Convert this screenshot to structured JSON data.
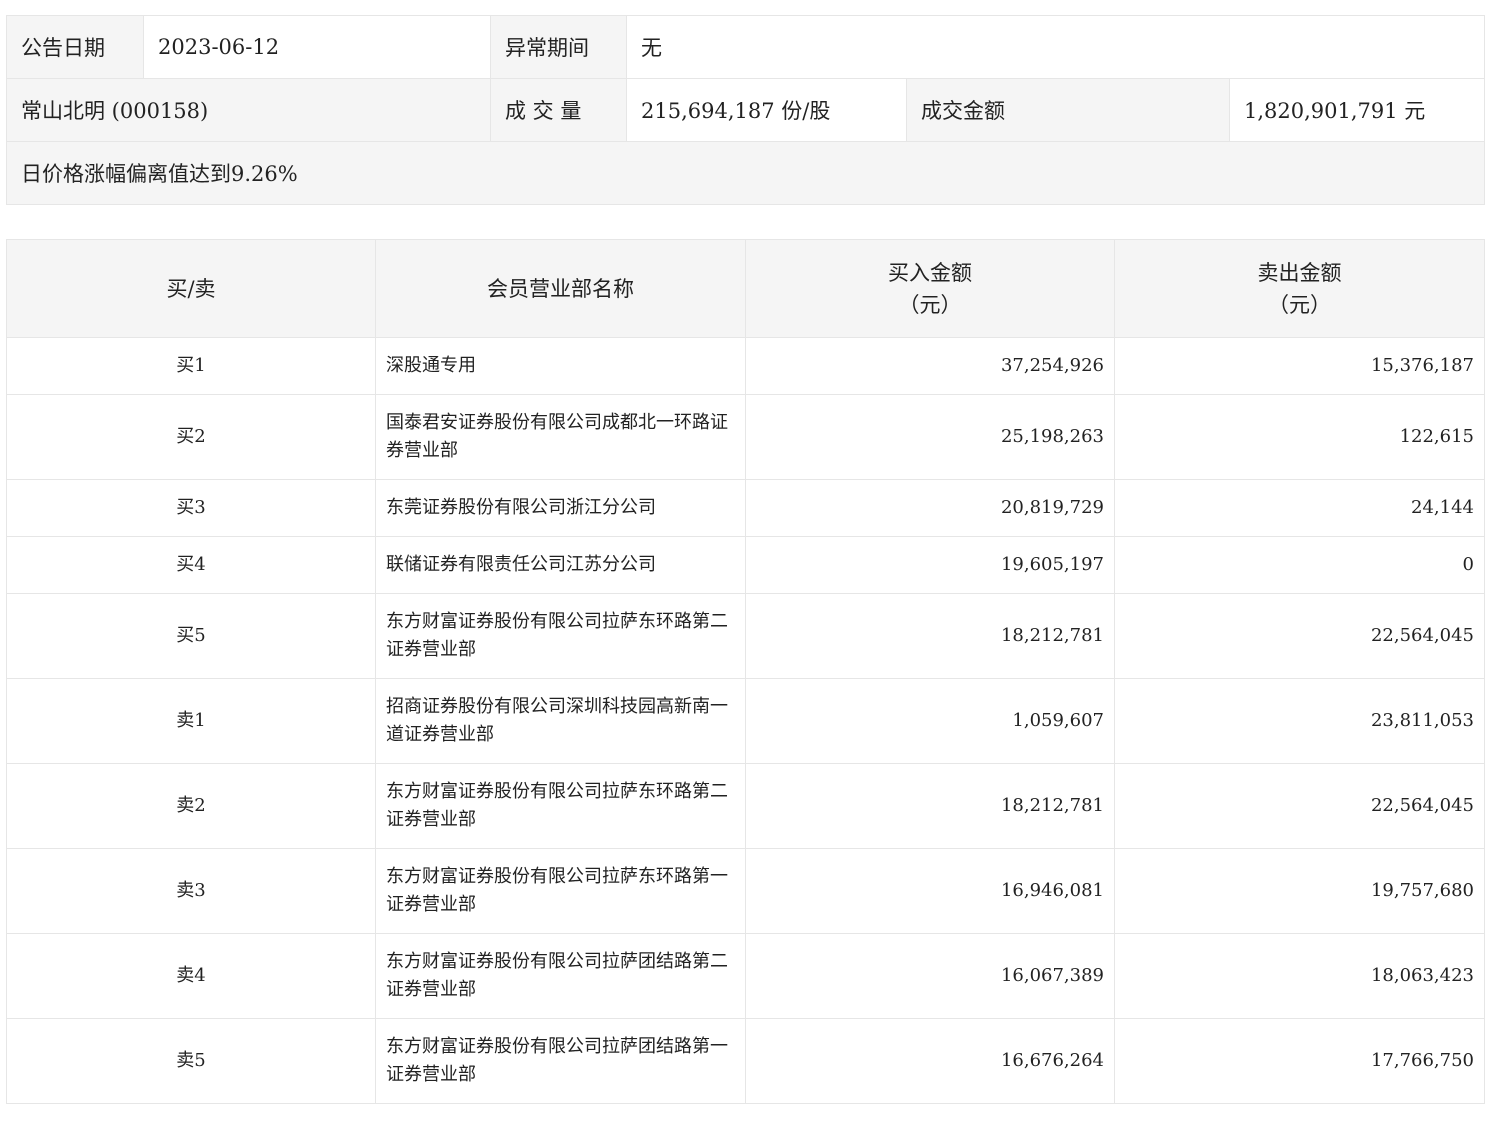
{
  "info": {
    "announce_date_label": "公告日期",
    "announce_date": "2023-06-12",
    "abnormal_period_label": "异常期间",
    "abnormal_period": "无",
    "stock": "常山北明 (000158)",
    "volume_label": "成 交 量",
    "volume": "215,694,187 份/股",
    "amount_label": "成交金额",
    "amount": "1,820,901,791 元",
    "reason": "日价格涨幅偏离值达到9.26%"
  },
  "trade_table": {
    "headers": {
      "side": "买/卖",
      "member": "会员营业部名称",
      "buy_title": "买入金额",
      "buy_unit": "（元）",
      "sell_title": "卖出金额",
      "sell_unit": "（元）"
    },
    "rows": [
      {
        "side": "买1",
        "name": "深股通专用",
        "buy": "37,254,926",
        "sell": "15,376,187"
      },
      {
        "side": "买2",
        "name": "国泰君安证券股份有限公司成都北一环路证券营业部",
        "buy": "25,198,263",
        "sell": "122,615"
      },
      {
        "side": "买3",
        "name": "东莞证券股份有限公司浙江分公司",
        "buy": "20,819,729",
        "sell": "24,144"
      },
      {
        "side": "买4",
        "name": "联储证券有限责任公司江苏分公司",
        "buy": "19,605,197",
        "sell": "0"
      },
      {
        "side": "买5",
        "name": "东方财富证券股份有限公司拉萨东环路第二证券营业部",
        "buy": "18,212,781",
        "sell": "22,564,045"
      },
      {
        "side": "卖1",
        "name": "招商证券股份有限公司深圳科技园高新南一道证券营业部",
        "buy": "1,059,607",
        "sell": "23,811,053"
      },
      {
        "side": "卖2",
        "name": "东方财富证券股份有限公司拉萨东环路第二证券营业部",
        "buy": "18,212,781",
        "sell": "22,564,045"
      },
      {
        "side": "卖3",
        "name": "东方财富证券股份有限公司拉萨东环路第一证券营业部",
        "buy": "16,946,081",
        "sell": "19,757,680"
      },
      {
        "side": "卖4",
        "name": "东方财富证券股份有限公司拉萨团结路第二证券营业部",
        "buy": "16,067,389",
        "sell": "18,063,423"
      },
      {
        "side": "卖5",
        "name": "东方财富证券股份有限公司拉萨团结路第一证券营业部",
        "buy": "16,676,264",
        "sell": "17,766,750"
      }
    ]
  }
}
